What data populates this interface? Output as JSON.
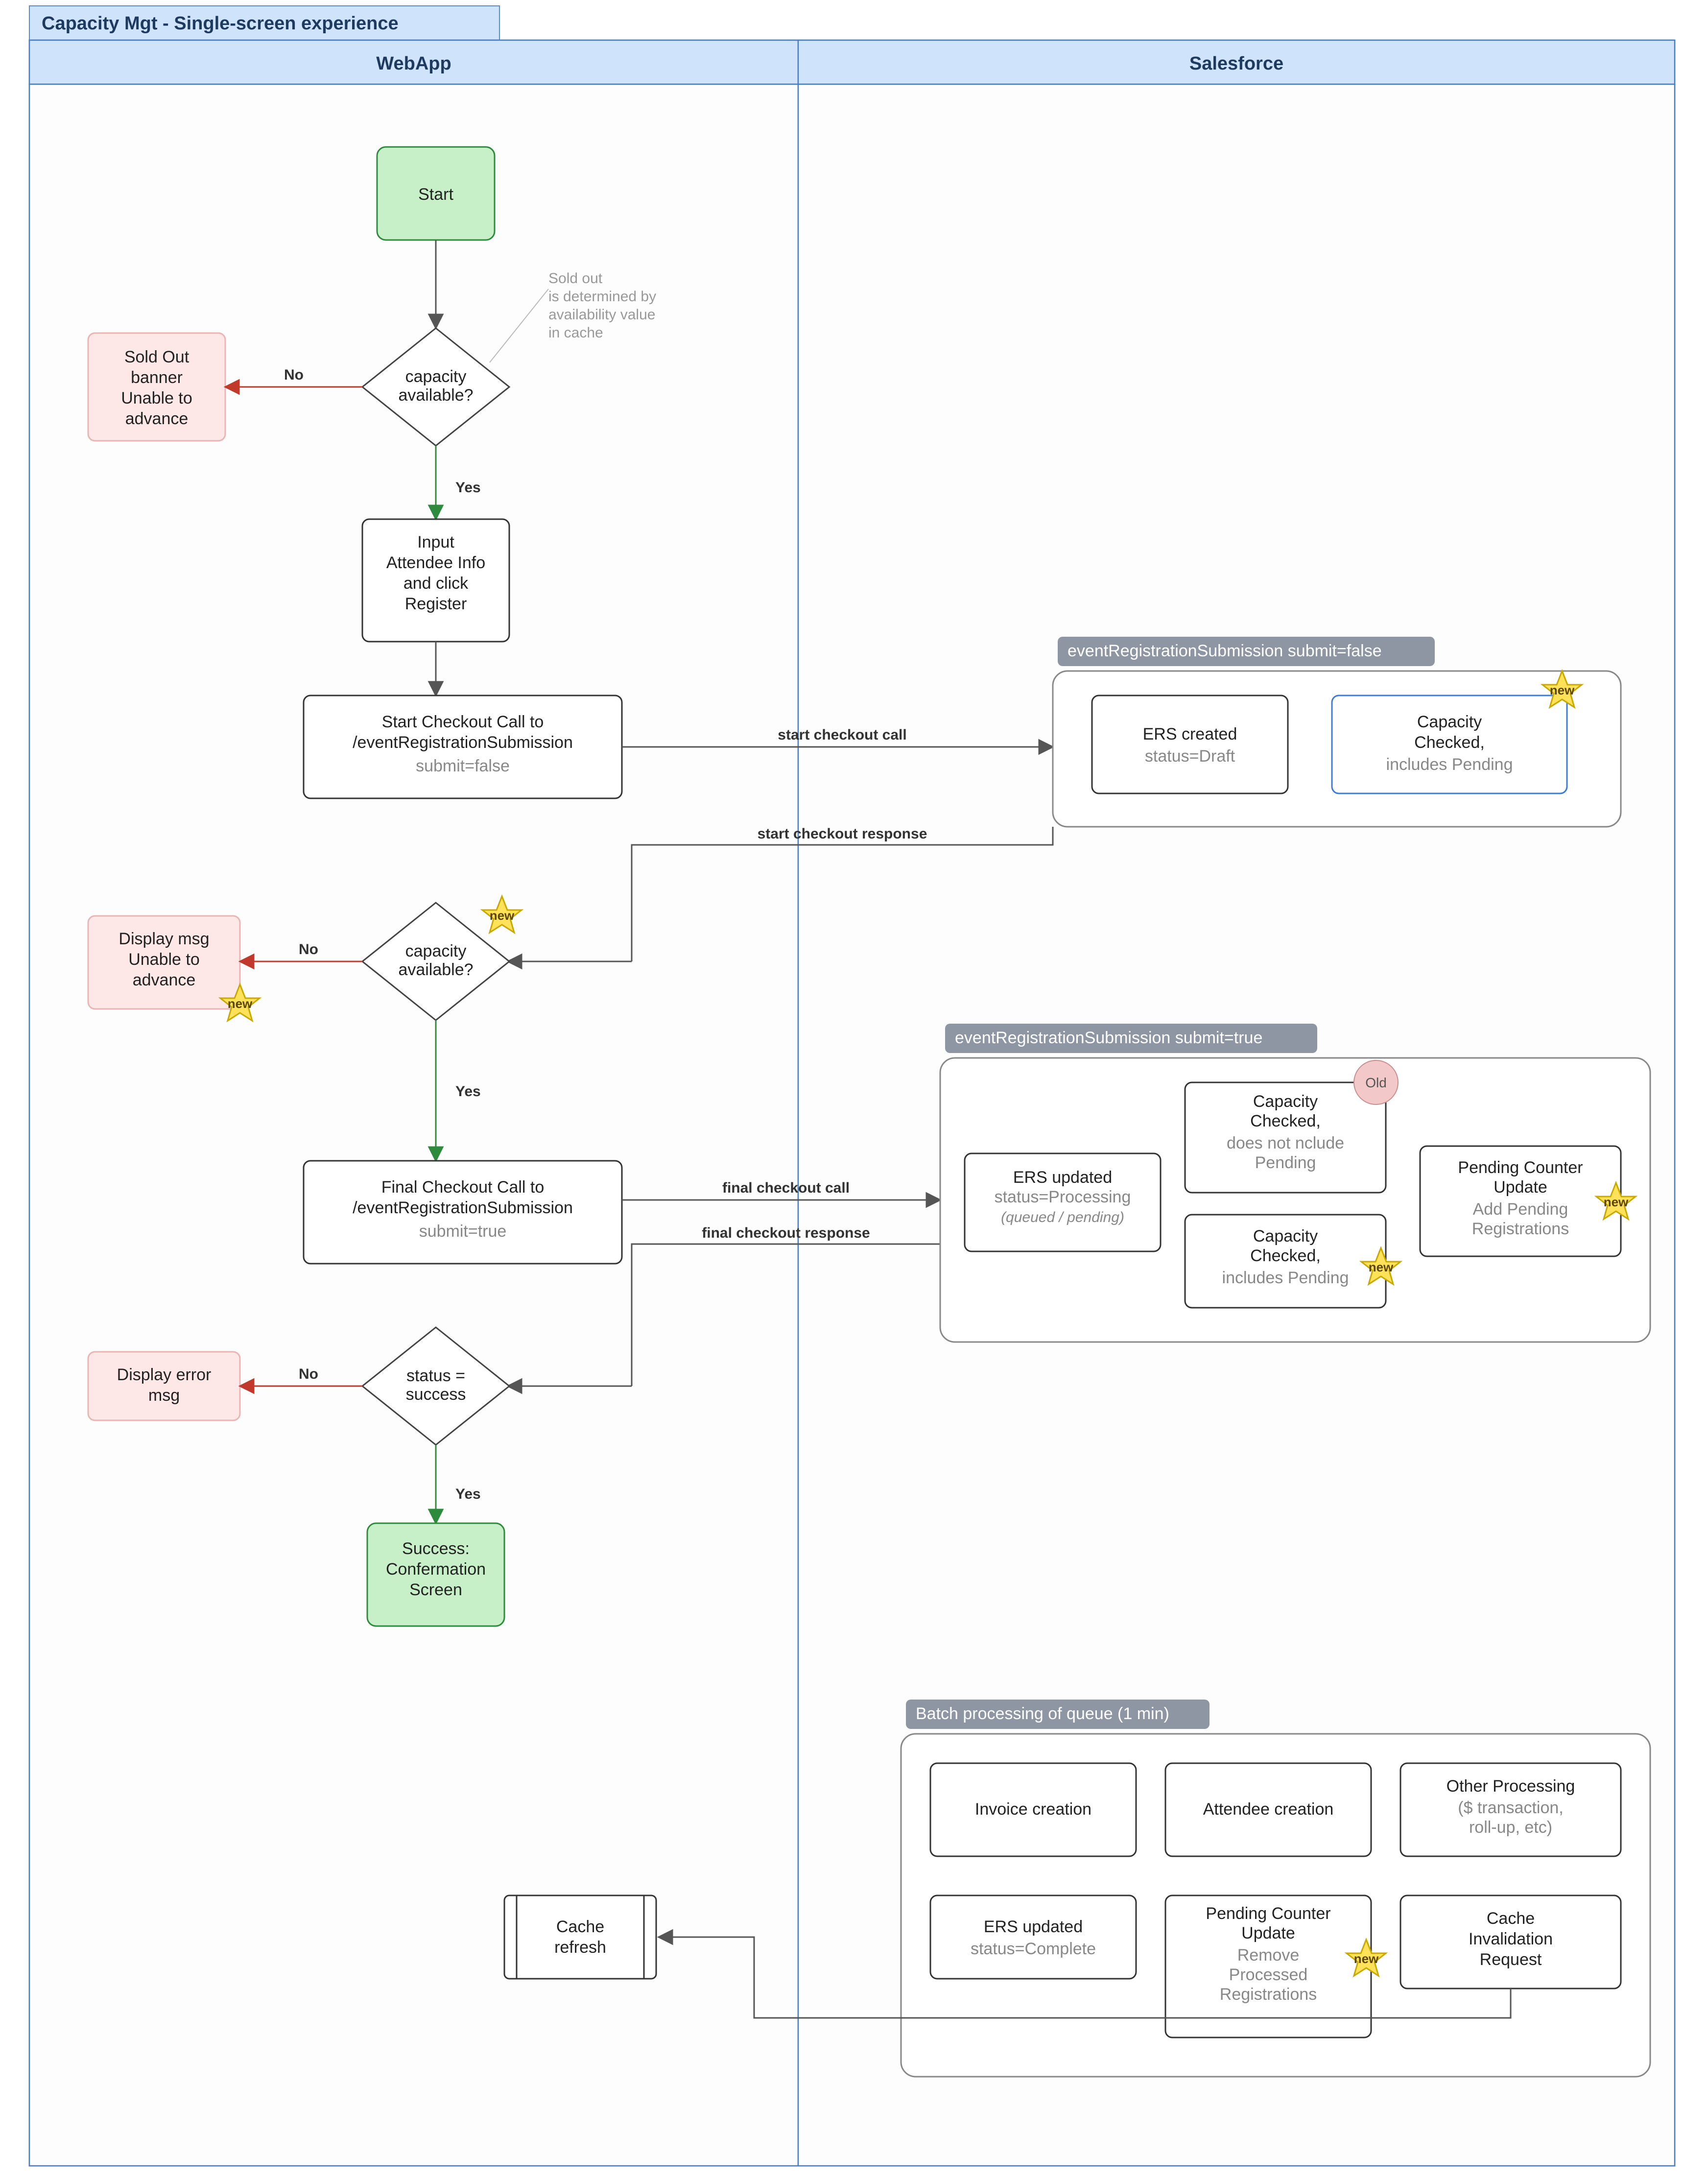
{
  "title": "Capacity Mgt - Single-screen experience",
  "lanes": {
    "left": "WebApp",
    "right": "Salesforce"
  },
  "nodes": {
    "start": "Start",
    "soldOutNote": [
      "Sold out",
      "is determined by",
      "availability value",
      "in cache"
    ],
    "cap1": [
      "capacity",
      "available?"
    ],
    "soldOut": [
      "Sold Out",
      "banner",
      "Unable to",
      "advance"
    ],
    "input": [
      "Input",
      "Attendee Info",
      "and click",
      "Register"
    ],
    "startCall": {
      "l1": "Start Checkout Call to",
      "l2": "/eventRegistrationSubmission",
      "l3": "submit=false"
    },
    "cap2": [
      "capacity",
      "available?"
    ],
    "dispMsg": [
      "Display msg",
      "Unable to",
      "advance"
    ],
    "finalCall": {
      "l1": "Final Checkout Call to",
      "l2": "/eventRegistrationSubmission",
      "l3": "submit=true"
    },
    "status": [
      "status =",
      "success"
    ],
    "dispErr": [
      "Display error",
      "msg"
    ],
    "success": [
      "Success:",
      "Confermation",
      "Screen"
    ],
    "cacheRefresh": [
      "Cache",
      "refresh"
    ],
    "ersCreated": {
      "l1": "ERS created",
      "l2": "status=Draft"
    },
    "capCheck1": [
      "Capacity",
      "Checked,",
      "includes Pending"
    ],
    "ersUpdated": {
      "l1": "ERS updated",
      "l2": "status=Processing",
      "l3": "(queued / pending)"
    },
    "capNotPending": {
      "l1": "Capacity",
      "l2": "Checked,",
      "l3": "does not nclude",
      "l4": "Pending"
    },
    "capPending": [
      "Capacity",
      "Checked,",
      "includes Pending"
    ],
    "pendCounterAdd": {
      "l1": "Pending Counter",
      "l2": "Update",
      "l3": "Add Pending",
      "l4": "Registrations"
    },
    "invoice": "Invoice creation",
    "attendee": "Attendee creation",
    "otherProc": {
      "l1": "Other Processing",
      "l2": "($ transaction,",
      "l3": "roll-up, etc)"
    },
    "ersComplete": {
      "l1": "ERS updated",
      "l2": "status=Complete"
    },
    "pendCounterRem": {
      "l1": "Pending Counter",
      "l2": "Update",
      "l3": "Remove",
      "l4": "Processed",
      "l5": "Registrations"
    },
    "cacheInvalid": [
      "Cache",
      "Invalidation",
      "Request"
    ]
  },
  "clusters": {
    "c1": "eventRegistrationSubmission    submit=false",
    "c2": "eventRegistrationSubmission    submit=true",
    "c3": "Batch processing of queue (1 min)"
  },
  "edges": {
    "no": "No",
    "yes": "Yes",
    "startCheckoutCall": "start checkout call",
    "startCheckoutResp": "start checkout response",
    "finalCheckoutCall": "final checkout call",
    "finalCheckoutResp": "final checkout response"
  },
  "badges": {
    "new": "new",
    "old": "Old"
  }
}
